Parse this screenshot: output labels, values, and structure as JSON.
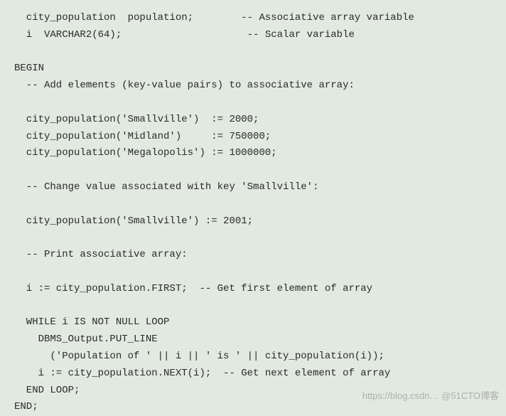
{
  "code": {
    "l1": "  city_population  population;        -- Associative array variable",
    "l2": "  i  VARCHAR2(64);                     -- Scalar variable",
    "l3": "",
    "l4": "BEGIN",
    "l5": "  -- Add elements (key-value pairs) to associative array:",
    "l6": "",
    "l7": "  city_population('Smallville')  := 2000;",
    "l8": "  city_population('Midland')     := 750000;",
    "l9": "  city_population('Megalopolis') := 1000000;",
    "l10": "",
    "l11": "  -- Change value associated with key 'Smallville':",
    "l12": "",
    "l13": "  city_population('Smallville') := 2001;",
    "l14": "",
    "l15": "  -- Print associative array:",
    "l16": "",
    "l17": "  i := city_population.FIRST;  -- Get first element of array",
    "l18": "",
    "l19": "  WHILE i IS NOT NULL LOOP",
    "l20": "    DBMS_Output.PUT_LINE",
    "l21": "      ('Population of ' || i || ' is ' || city_population(i));",
    "l22": "    i := city_population.NEXT(i);  -- Get next element of array",
    "l23": "  END LOOP;",
    "l24": "END;"
  },
  "watermark": "https://blog.csdn… @51CTO博客"
}
